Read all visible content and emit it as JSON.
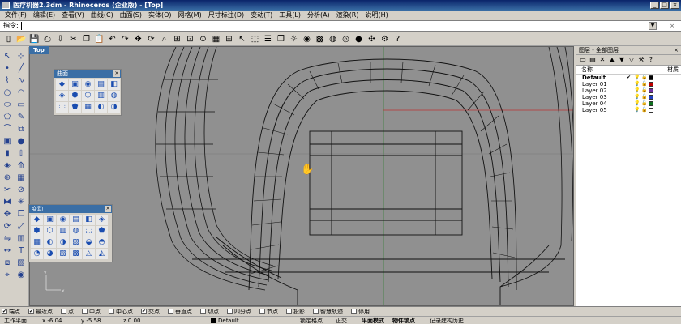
{
  "window": {
    "title": "医疗机器2.3dm - Rhinoceros (企业版) - [Top]",
    "minimize": "_",
    "maximize": "□",
    "close": "×"
  },
  "menu": [
    "文件(F)",
    "编辑(E)",
    "查看(V)",
    "曲线(C)",
    "曲面(S)",
    "实体(O)",
    "网格(M)",
    "尺寸标注(D)",
    "变动(T)",
    "工具(L)",
    "分析(A)",
    "渲染(R)",
    "说明(H)"
  ],
  "command": {
    "prompt": "指令:",
    "dropdown": "▼",
    "close": "×"
  },
  "toolbar_icons": [
    "new-file-icon",
    "open-file-icon",
    "save-icon",
    "print-icon",
    "import-icon",
    "cut-icon",
    "copy-icon",
    "paste-icon",
    "undo-icon",
    "redo-icon",
    "pan-icon",
    "rotate-view-icon",
    "zoom-icon",
    "zoom-window-icon",
    "zoom-extents-icon",
    "zoom-selected-icon",
    "grid-icon",
    "four-views-icon",
    "select-icon",
    "cplane-icon",
    "object-properties-icon",
    "layer-icon",
    "light-icon",
    "render-icon",
    "texture-icon",
    "color-wheel-icon",
    "globe-icon",
    "sphere-icon",
    "osnap-icon",
    "options-icon",
    "help-icon"
  ],
  "viewport": {
    "label": "Top"
  },
  "palette_surface": {
    "title": "曲面",
    "close": "×"
  },
  "palette_transform": {
    "title": "变动",
    "close": "×"
  },
  "layers": {
    "title": "图层 - 全部图层",
    "close": "×",
    "header_name": "名称",
    "header_material": "材质",
    "rows": [
      {
        "name": "Default",
        "current": "✔",
        "color": "#000000"
      },
      {
        "name": "Layer 01",
        "current": "",
        "color": "#c00000"
      },
      {
        "name": "Layer 02",
        "current": "",
        "color": "#7030a0"
      },
      {
        "name": "Layer 03",
        "current": "",
        "color": "#1f3fbf"
      },
      {
        "name": "Layer 04",
        "current": "",
        "color": "#107020"
      },
      {
        "name": "Layer 05",
        "current": "",
        "color": "#ffffff"
      }
    ]
  },
  "osnap": [
    {
      "label": "端点",
      "checked": true
    },
    {
      "label": "最近点",
      "checked": true
    },
    {
      "label": "点",
      "checked": false
    },
    {
      "label": "中点",
      "checked": false
    },
    {
      "label": "中心点",
      "checked": false
    },
    {
      "label": "交点",
      "checked": true
    },
    {
      "label": "垂直点",
      "checked": false
    },
    {
      "label": "切点",
      "checked": false
    },
    {
      "label": "四分点",
      "checked": false
    },
    {
      "label": "节点",
      "checked": false
    },
    {
      "label": "投影",
      "checked": false
    },
    {
      "label": "智慧轨迹",
      "checked": false
    },
    {
      "label": "停用",
      "checked": false
    }
  ],
  "status": {
    "cplane": "工作平面",
    "x": "x -6.04",
    "y": "y -5.58",
    "z": "z 0.00",
    "layer": "Default",
    "lock_grid": "锁定格点",
    "ortho": "正交",
    "planar": "平面模式",
    "osnap": "物件锁点",
    "history": "记录建构历史"
  },
  "colors": {
    "accent": "#3a6ea5",
    "viewport_bg": "#909090",
    "wire": "#111111"
  }
}
